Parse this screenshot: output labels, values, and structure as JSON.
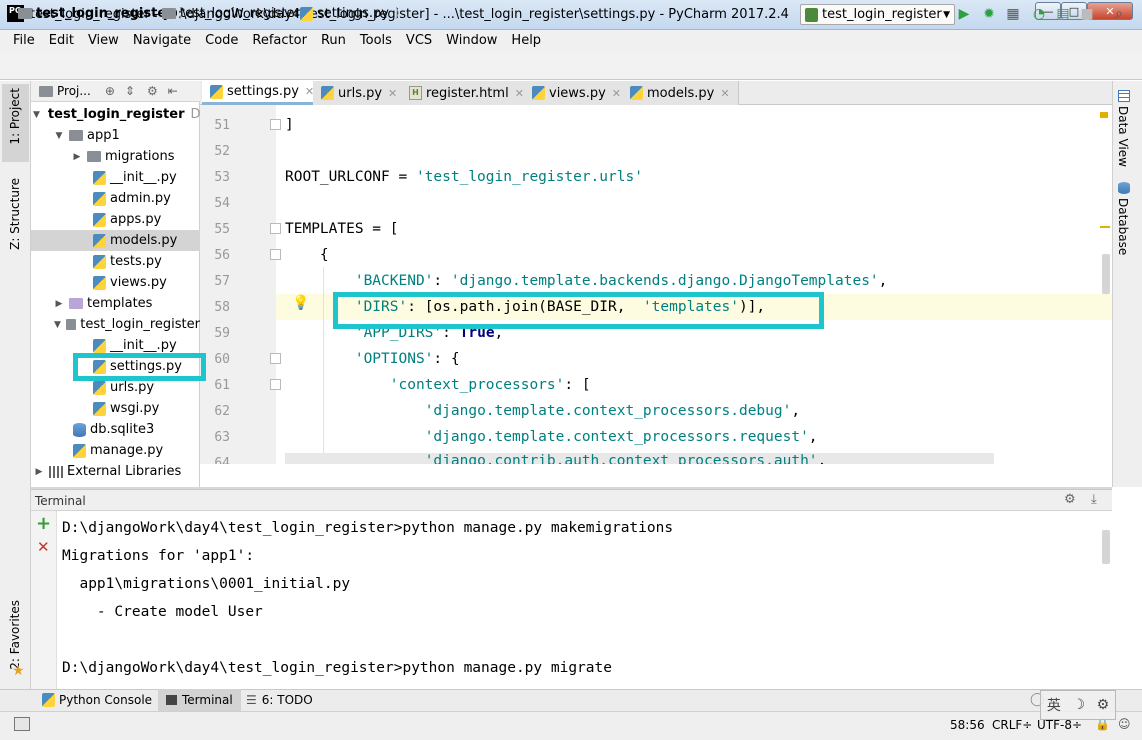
{
  "window": {
    "title": "test_login_register - [D:\\djangoWork\\day4\\test_login_register] - ...\\test_login_register\\settings.py - PyCharm 2017.2.4",
    "logo": "PC",
    "minimize": "—",
    "maximize": "□",
    "close": "✕"
  },
  "menu": [
    "File",
    "Edit",
    "View",
    "Navigate",
    "Code",
    "Refactor",
    "Run",
    "Tools",
    "VCS",
    "Window",
    "Help"
  ],
  "breadcrumb": [
    "test_login_register",
    "test_login_register",
    "settings.py"
  ],
  "run_config": "test_login_register",
  "left_strip": {
    "project": "1: Project",
    "structure": "Z: Structure",
    "favorites": "2: Favorites"
  },
  "right_strip": {
    "data_view": "Data View",
    "database": "Database"
  },
  "project_panel": {
    "title": "Proj..."
  },
  "tree": [
    {
      "label": "test_login_register",
      "suffix": "D",
      "bold": true
    },
    {
      "label": "app1"
    },
    {
      "label": "migrations"
    },
    {
      "label": "__init__.py"
    },
    {
      "label": "admin.py"
    },
    {
      "label": "apps.py"
    },
    {
      "label": "models.py"
    },
    {
      "label": "tests.py"
    },
    {
      "label": "views.py"
    },
    {
      "label": "templates"
    },
    {
      "label": "test_login_register"
    },
    {
      "label": "__init__.py"
    },
    {
      "label": "settings.py"
    },
    {
      "label": "urls.py"
    },
    {
      "label": "wsgi.py"
    },
    {
      "label": "db.sqlite3"
    },
    {
      "label": "manage.py"
    },
    {
      "label": "External Libraries"
    }
  ],
  "tabs": [
    {
      "label": "settings.py",
      "active": true
    },
    {
      "label": "urls.py"
    },
    {
      "label": "register.html"
    },
    {
      "label": "views.py"
    },
    {
      "label": "models.py"
    }
  ],
  "editor": {
    "line_numbers": [
      "51",
      "52",
      "53",
      "54",
      "55",
      "56",
      "57",
      "58",
      "59",
      "60",
      "61",
      "62",
      "63",
      "64"
    ],
    "lines": [
      {
        "a": "]"
      },
      {
        "a": ""
      },
      {
        "a": "ROOT_URLCONF = ",
        "s": "'test_login_register.urls'"
      },
      {
        "a": ""
      },
      {
        "a": "TEMPLATES = ["
      },
      {
        "a": "    {"
      },
      {
        "a": "        ",
        "s": "'BACKEND'",
        "b": ": ",
        "s2": "'django.template.backends.django.DjangoTemplates'",
        "c": ","
      },
      {
        "a": "        ",
        "s": "'DIRS'",
        "b": ": [os.path.join(BASE_DIR,  ",
        "s2": "'templates'",
        "c": ")],"
      },
      {
        "a": "        ",
        "s": "'APP_DIRS'",
        "b": ": ",
        "k": "True",
        "c": ","
      },
      {
        "a": "        ",
        "s": "'OPTIONS'",
        "b": ": {"
      },
      {
        "a": "            ",
        "s": "'context_processors'",
        "b": ": ["
      },
      {
        "a": "                ",
        "s": "'django.template.context_processors.debug'",
        "b": ","
      },
      {
        "a": "                ",
        "s": "'django.template.context_processors.request'",
        "b": ","
      },
      {
        "a": "                ",
        "s": "'django.contrib.auth.context_processors.auth'",
        "b": ","
      }
    ]
  },
  "terminal": {
    "title": "Terminal",
    "lines": [
      "D:\\djangoWork\\day4\\test_login_register>python manage.py makemigrations",
      "Migrations for 'app1':",
      "  app1\\migrations\\0001_initial.py",
      "    - Create model User",
      "",
      "D:\\djangoWork\\day4\\test_login_register>python manage.py migrate"
    ],
    "add": "+",
    "close": "✕"
  },
  "bottom_tabs": [
    "Python Console",
    "Terminal",
    "6: TODO"
  ],
  "status": {
    "position": "58:56",
    "line_sep": "CRLF÷",
    "encoding": "UTF-8÷"
  },
  "ime": [
    "英",
    "☽",
    "⚙"
  ]
}
